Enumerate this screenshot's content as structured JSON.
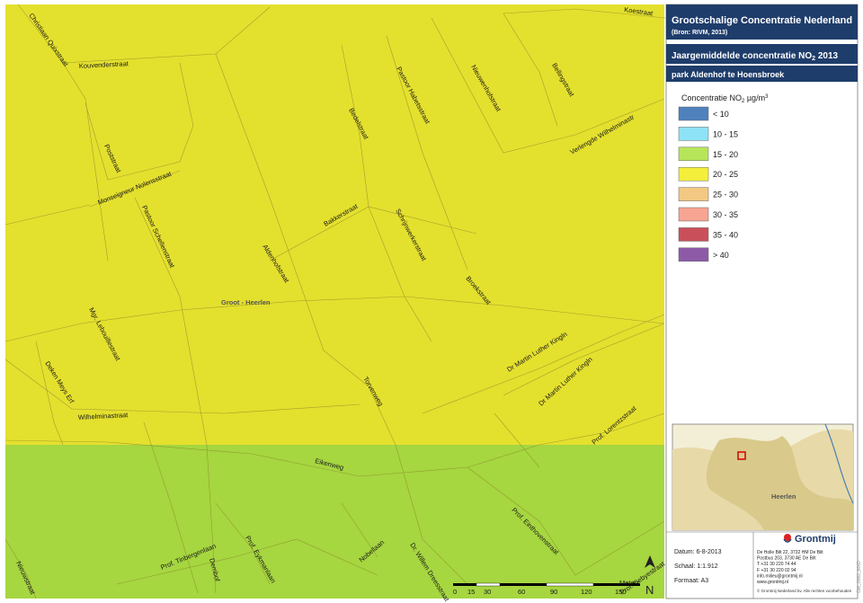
{
  "header": {
    "title": "Grootschalige Concentratie Nederland",
    "subtitle": "(Bron: RIVM, 2013)",
    "map_title_prefix": "Jaargemiddelde concentratie NO",
    "map_title_sub": "2",
    "map_title_suffix": " 2013",
    "location": "park Aldenhof te Hoensbroek"
  },
  "legend": {
    "title_prefix": "Concentratie NO",
    "title_sub": "2",
    "title_unit": " µg/m",
    "title_sup": "3",
    "classes": [
      {
        "label": "< 10",
        "color": "#4f81bd"
      },
      {
        "label": "10 - 15",
        "color": "#8de3f5"
      },
      {
        "label": "15 - 20",
        "color": "#b7e55a"
      },
      {
        "label": "20 - 25",
        "color": "#f3ef3a"
      },
      {
        "label": "25 - 30",
        "color": "#f3c882"
      },
      {
        "label": "30 - 35",
        "color": "#f7a493"
      },
      {
        "label": "35 - 40",
        "color": "#c9505b"
      },
      {
        "label": "> 40",
        "color": "#8d5aa8"
      }
    ]
  },
  "map_zones": {
    "upper_color": "#e4e02e",
    "lower_color": "#a6d640"
  },
  "streets": {
    "s1": "Christiaan Quixstraat",
    "s2": "Kouvenderstraat",
    "s3": "Koestraat",
    "s4": "Bellingstraat",
    "s5": "Nieuwenhofstraat",
    "s6": "Pastoor Habetsstraat",
    "s7": "Bedelstraat",
    "s8": "Verlengde Wilhelminastr",
    "s9": "Poststraat",
    "s10": "Monseigneur Nolensstraat",
    "s11": "Pastoor Schellenstraat",
    "s12": "Bakkerstraat",
    "s13": "Schrijnwerkerstraat",
    "s14": "Aldenhofstraat",
    "s15": "Broekstraat",
    "s16": "Mgr. Lebouillestraat",
    "s17": "Dr Martin Luther Kingln",
    "s18": "Dr Martin Luther Kingln",
    "s19": "Deken Meys Erf",
    "s20": "Torvenweg",
    "s21": "Wilhelminastraat",
    "s22": "Prof. Lorentzstraat",
    "s23": "Eikenweg",
    "s24": "Prof. Einthovenstraat",
    "s25": "Prof. Tinbergenlaan",
    "s26": "Prof. Eykmanlaan",
    "s27": "Nobellaan",
    "s28": "Dr. Willem Dreesstraat",
    "s29": "Nieuwstraat",
    "s30": "Dembof",
    "s31": "Prof. Debyestraat"
  },
  "places": {
    "groot_heerlen": "Groot - Heerlen",
    "inset_heerlen": "Heerlen"
  },
  "scalebar": {
    "ticks": [
      "0",
      "15",
      "30",
      "60",
      "90",
      "120",
      "150"
    ],
    "unit": "Meters"
  },
  "north_arrow": "N",
  "footer": {
    "datum": "Datum: 6-8-2013",
    "schaal": "Schaal: 1:1.912",
    "formaat": "Formaat: A3",
    "company": "Grontmij",
    "address_lines": [
      "De Holle Bilt 22, 3732 HM De Bilt",
      "Postbus 203, 3730 AE De Bilt",
      "T +31 30 220 74 44",
      "F +31 30 220 02 94",
      "info.milieu@grontmij.nl",
      "www.grontmij.nl"
    ],
    "copyright": "© Grontmij Nederland bv. Alle rechten voorbehouden",
    "side_code": "GM_0062_MXD"
  }
}
